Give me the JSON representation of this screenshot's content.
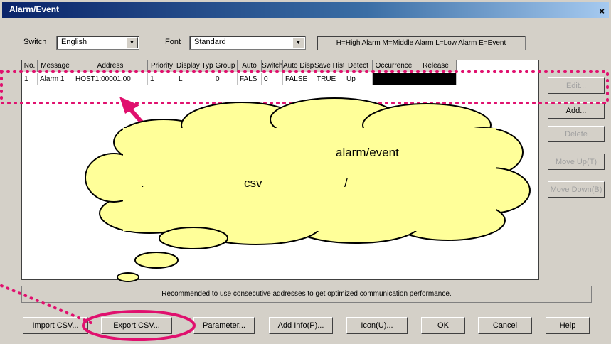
{
  "window": {
    "title": "Alarm/Event",
    "close_label": "×"
  },
  "toolbar": {
    "switch_label": "Switch",
    "switch_value": "English",
    "font_label": "Font",
    "font_value": "Standard",
    "legend": "H=High Alarm M=Middle Alarm L=Low Alarm E=Event"
  },
  "table": {
    "columns": [
      "No.",
      "Message",
      "Address",
      "Priority",
      "Display Type",
      "Group",
      "Auto",
      "Switch",
      "Auto Display",
      "Save History",
      "Detect",
      "Occurrence",
      "Release"
    ],
    "rows": [
      [
        "1",
        "Alarm 1",
        "HOST1:00001.00",
        "1",
        "L",
        "0",
        "FALS",
        "0",
        "FALSE",
        "TRUE",
        "Up",
        "",
        ""
      ]
    ]
  },
  "side_buttons": {
    "edit": "Edit...",
    "add": "Add...",
    "delete": "Delete",
    "move_up": "Move Up(T)",
    "move_down": "Move Down(B)"
  },
  "status": "Recommended to use consecutive addresses to get optimized communication performance.",
  "bottom_buttons": {
    "import": "Import CSV...",
    "export": "Export CSV...",
    "parameter": "Parameter...",
    "add_info": "Add Info(P)...",
    "icon": "Icon(U)...",
    "ok": "OK",
    "cancel": "Cancel",
    "help": "Help"
  },
  "callout": {
    "line1": "alarm/event",
    "csv": "csv",
    "slash": "/",
    "dot": "."
  },
  "colors": {
    "title_bar": "#0a246a",
    "callout_fill": "#ffff99",
    "annotation": "#e0106e"
  }
}
